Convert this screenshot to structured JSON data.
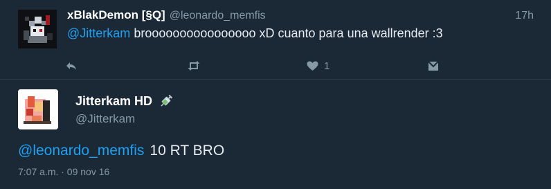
{
  "reply_tweet": {
    "display_name": "xBlakDemon [§Q]",
    "handle": "@leonardo_memfis",
    "time": "17h",
    "mention": "@Jitterkam",
    "text": "broooooooooooooooo xD cuanto para una wallrender :3",
    "like_count": "1",
    "icons": [
      "reply-icon",
      "retweet-icon",
      "heart-icon",
      "direct-message-icon"
    ]
  },
  "main_tweet": {
    "display_name": "Jitterkam HD",
    "name_emoji": "syringe-emoji",
    "handle": "@Jitterkam",
    "mention": "@leonardo_memfis",
    "text": "10 RT BRO",
    "timestamp": "7:07 a.m. · 09 nov 16"
  },
  "colors": {
    "background": "#1b2836",
    "link": "#1da1f2",
    "muted": "#8899a6",
    "divider": "#2f3d4d"
  }
}
